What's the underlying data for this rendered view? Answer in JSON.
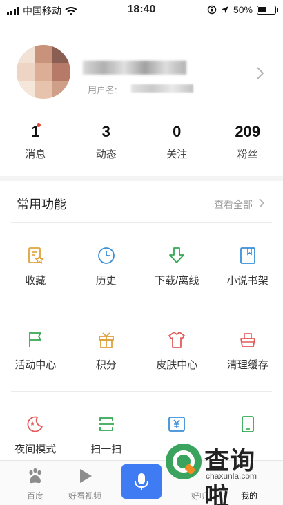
{
  "status_bar": {
    "carrier": "中国移动",
    "time": "18:40",
    "battery": "50%"
  },
  "profile": {
    "username_label": "用户名:",
    "stats": [
      {
        "value": "1",
        "label": "消息",
        "has_dot": true
      },
      {
        "value": "3",
        "label": "动态"
      },
      {
        "value": "0",
        "label": "关注"
      },
      {
        "value": "209",
        "label": "粉丝"
      }
    ]
  },
  "functions": {
    "title": "常用功能",
    "view_all": "查看全部",
    "items": [
      {
        "label": "收藏",
        "icon": "favorites-icon",
        "color": "#e0a23a"
      },
      {
        "label": "历史",
        "icon": "history-clock-icon",
        "color": "#3a8fd8"
      },
      {
        "label": "下载/离线",
        "icon": "download-icon",
        "color": "#34a853"
      },
      {
        "label": "小说书架",
        "icon": "bookshelf-icon",
        "color": "#3a8fd8"
      },
      {
        "label": "活动中心",
        "icon": "flag-icon",
        "color": "#34a853"
      },
      {
        "label": "积分",
        "icon": "gift-icon",
        "color": "#e0a23a"
      },
      {
        "label": "皮肤中心",
        "icon": "shirt-icon",
        "color": "#e35b5b"
      },
      {
        "label": "清理缓存",
        "icon": "clean-basket-icon",
        "color": "#e35b5b"
      },
      {
        "label": "夜间模式",
        "icon": "night-mode-icon",
        "color": "#e35b5b"
      },
      {
        "label": "扫一扫",
        "icon": "scan-icon",
        "color": "#34a853"
      },
      {
        "label": "",
        "icon": "yuan-wallet-icon",
        "color": "#3a8fd8"
      },
      {
        "label": "",
        "icon": "tablet-icon",
        "color": "#34a853"
      }
    ]
  },
  "tabbar": {
    "tabs": [
      {
        "label": "百度",
        "icon": "baidu-paw-icon"
      },
      {
        "label": "好看视频",
        "icon": "play-icon"
      },
      {
        "label": "好听",
        "icon": "listen-icon"
      },
      {
        "label": "我的",
        "icon": "mine-icon",
        "active": true
      }
    ]
  },
  "watermark": {
    "text": "查询啦",
    "url": "chaxunla.com"
  }
}
